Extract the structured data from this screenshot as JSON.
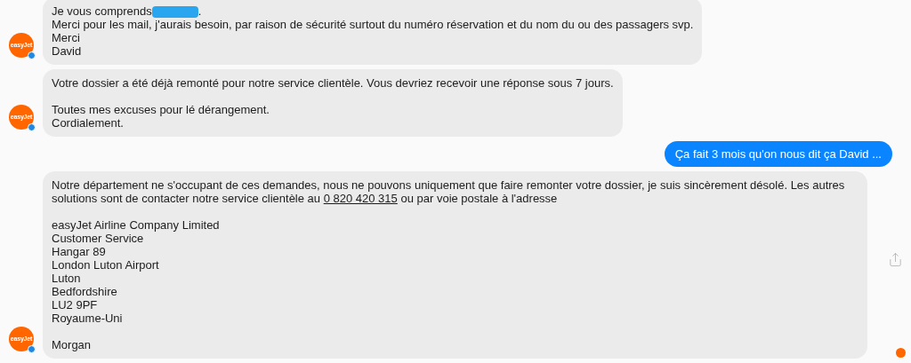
{
  "messages": [
    {
      "kind": "received",
      "avatar": {
        "label": "easyJet"
      },
      "paragraphs": [
        [
          {
            "segments": [
              {
                "kind": "text",
                "text": "Je vous comprends"
              },
              {
                "kind": "redacted"
              },
              {
                "kind": "text",
                "text": "."
              }
            ]
          },
          "Merci pour les mail, j'aurais besoin, par raison de sécurité surtout du numéro réservation et du nom du ou des passagers svp.",
          "Merci",
          "David"
        ]
      ]
    },
    {
      "kind": "received",
      "avatar": {
        "label": "easyJet"
      },
      "paragraphs": [
        [
          "Votre dossier a été déjà remonté pour notre service clientèle. Vous devriez recevoir une réponse sous 7 jours."
        ],
        [
          "Toutes mes excuses pour lé dérangement.",
          "Cordialement."
        ]
      ]
    },
    {
      "kind": "sent",
      "paragraphs": [
        [
          "Ça fait 3 mois qu'on nous dit ça David ..."
        ]
      ]
    },
    {
      "kind": "received",
      "avatar": {
        "label": "easyJet"
      },
      "share": true,
      "read_receipt": true,
      "paragraphs": [
        [
          {
            "segments": [
              {
                "kind": "text",
                "text": "Notre département ne s'occupant de ces demandes, nous ne pouvons uniquement que faire remonter votre dossier, je suis sincèrement désolé. Les autres solutions sont de contacter notre service clientèle au "
              },
              {
                "kind": "link",
                "text": "0 820 420 315"
              },
              {
                "kind": "text",
                "text": " ou par voie postale à l'adresse"
              }
            ]
          }
        ],
        [
          "easyJet Airline Company Limited",
          "Customer Service",
          "Hangar 89",
          "London Luton Airport",
          "Luton",
          "Bedfordshire",
          "LU2 9PF",
          "Royaume-Uni"
        ],
        [
          "Morgan"
        ]
      ]
    }
  ]
}
